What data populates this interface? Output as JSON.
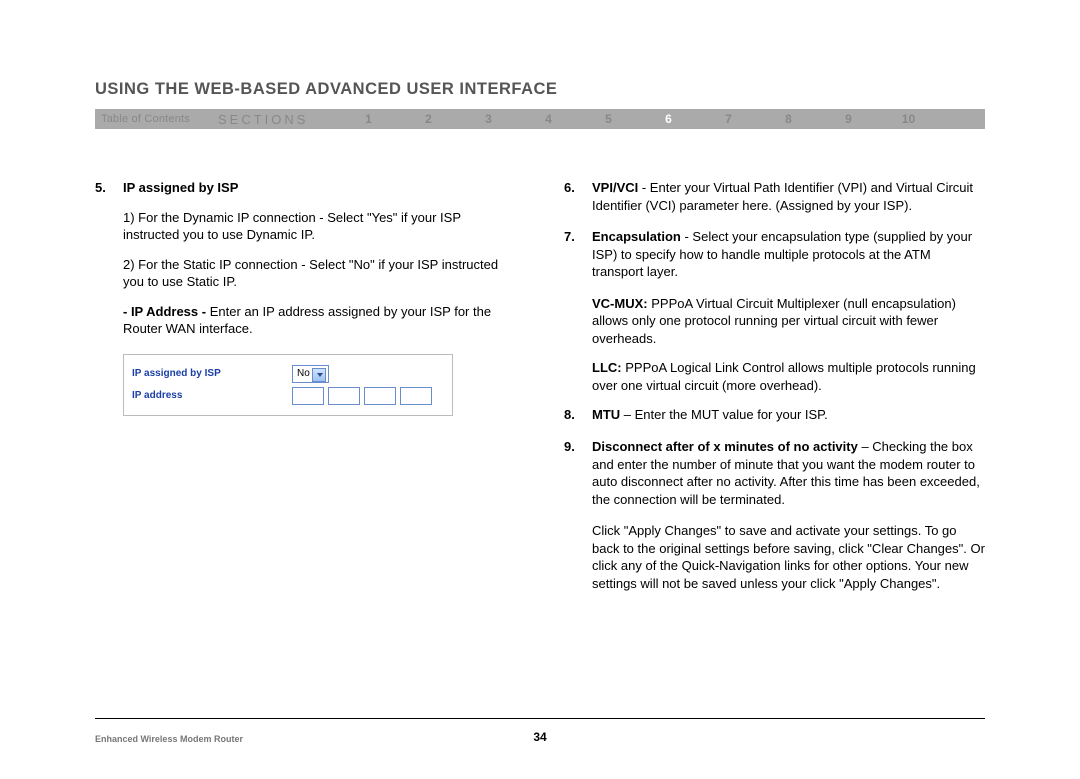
{
  "title": "USING THE WEB-BASED ADVANCED USER INTERFACE",
  "nav": {
    "toc": "Table of Contents",
    "sections_label": "SECTIONS",
    "items": [
      "1",
      "2",
      "3",
      "4",
      "5",
      "6",
      "7",
      "8",
      "9",
      "10"
    ],
    "active": "6"
  },
  "left": {
    "item5_num": "5.",
    "item5_title": "IP assigned by ISP",
    "item5_p1": "1) For the Dynamic IP connection - Select \"Yes\" if your ISP instructed you to use Dynamic IP.",
    "item5_p2": "2) For the Static IP connection - Select \"No\" if your ISP instructed you to use Static IP.",
    "item5_p3_bold": "- IP Address - ",
    "item5_p3_rest": "Enter an IP address assigned by your ISP for the Router WAN interface.",
    "ui_label1": "IP assigned by ISP",
    "ui_select_value": "No",
    "ui_label2": "IP address"
  },
  "right": {
    "item6_num": "6.",
    "item6_bold": "VPI/VCI",
    "item6_rest": " - Enter your Virtual Path Identifier (VPI) and Virtual Circuit Identifier (VCI) parameter here. (Assigned by your ISP).",
    "item7_num": "7.",
    "item7_bold": "Encapsulation",
    "item7_rest": " - Select your encapsulation type (supplied by your ISP) to specify how to handle multiple protocols at the ATM transport layer.",
    "vcmux_bold": "VC-MUX:",
    "vcmux_rest": " PPPoA Virtual Circuit Multiplexer (null encapsulation) allows only one protocol running per virtual circuit with fewer overheads.",
    "llc_bold": "LLC:",
    "llc_rest": " PPPoA Logical Link Control allows multiple protocols running over one virtual circuit (more overhead).",
    "item8_num": "8.",
    "item8_bold": "MTU",
    "item8_rest": " – Enter the MUT value for your ISP.",
    "item9_num": "9.",
    "item9_bold": "Disconnect after of x minutes of no activity",
    "item9_rest": " – Checking the box and enter the number of minute that you want the modem router to auto disconnect after no activity. After this time has been exceeded, the connection will be terminated.",
    "closing": "Click \"Apply Changes\" to save and activate your settings. To go back to the original settings before saving, click \"Clear Changes\". Or click any of the Quick-Navigation links for other options. Your new settings will not be saved unless your click \"Apply Changes\"."
  },
  "footer": {
    "left": "Enhanced Wireless Modem Router",
    "page": "34"
  }
}
